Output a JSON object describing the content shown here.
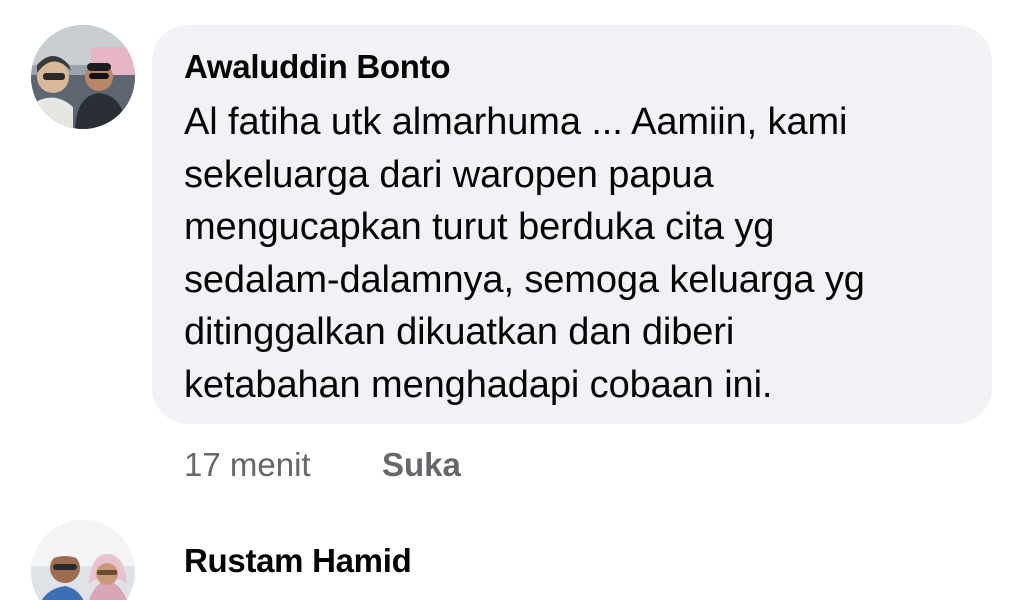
{
  "comments": [
    {
      "author": "Awaluddin Bonto",
      "lines": [
        "Al fatiha utk almarhuma ... Aamiin, kami",
        "sekeluarga dari waropen papua",
        "mengucapkan turut berduka cita yg",
        "sedalam-dalamnya, semoga keluarga yg",
        "ditinggalkan dikuatkan dan diberi",
        "ketabahan menghadapi cobaan ini."
      ],
      "time": "17 menit",
      "like_label": "Suka"
    },
    {
      "author": "Rustam Hamid"
    }
  ],
  "colors": {
    "bubble_background": "#f0f2f5",
    "text": "#050505",
    "meta_text": "#65676b"
  }
}
